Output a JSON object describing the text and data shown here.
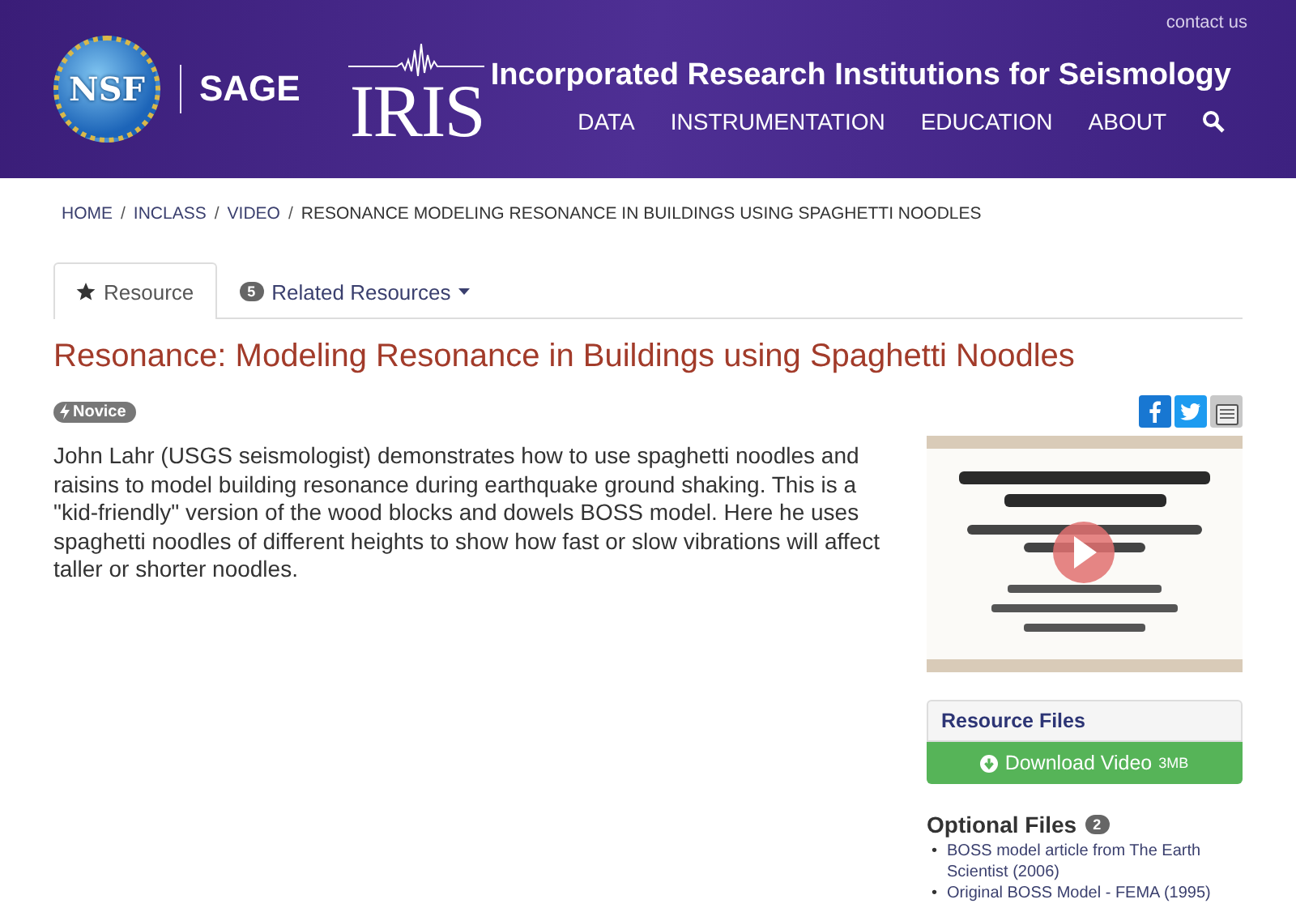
{
  "header": {
    "nsf_logo": "NSF",
    "sage_logo": "SAGE",
    "iris_logo": "IRIS",
    "org_name": "Incorporated Research Institutions for Seismology",
    "contact_link": "contact us",
    "nav": [
      "DATA",
      "INSTRUMENTATION",
      "EDUCATION",
      "ABOUT"
    ]
  },
  "breadcrumb": [
    {
      "label": "HOME",
      "link": true
    },
    {
      "separator": "/",
      "label": "INCLASS",
      "link": true
    },
    {
      "separator": "/",
      "label": "VIDEO",
      "link": true
    },
    {
      "separator": "/",
      "label": "RESONANCE MODELING RESONANCE IN BUILDINGS USING SPAGHETTI NOODLES",
      "link": false
    }
  ],
  "tabs": [
    {
      "label": "Resource",
      "kind": "icon",
      "selected": true
    },
    {
      "label": "Related Resources",
      "kind": "count",
      "count": "5",
      "dropdown": true,
      "selected": false
    }
  ],
  "title": "Resonance: Modeling Resonance in Buildings using Spaghetti Noodles",
  "level_badge": "Novice",
  "description": "John Lahr (USGS seismologist) demonstrates how to use spaghetti noodles and raisins to model building resonance during earthquake ground shaking. This is a \"kid-friendly\" version of the wood blocks and dowels BOSS model. Here he uses spaghetti noodles of different heights to show how fast or slow vibrations will affect taller or shorter noodles.",
  "resource_files": {
    "heading": "Resource Files",
    "download_label": "Download Video",
    "download_size": "3MB"
  },
  "optional_files": {
    "heading": "Optional Files",
    "count": "2",
    "items": [
      {
        "bullet": "•",
        "label": "BOSS model article from The Earth Scientist (2006)"
      },
      {
        "bullet": "•",
        "label": "Original BOSS Model - FEMA (1995)"
      }
    ]
  }
}
